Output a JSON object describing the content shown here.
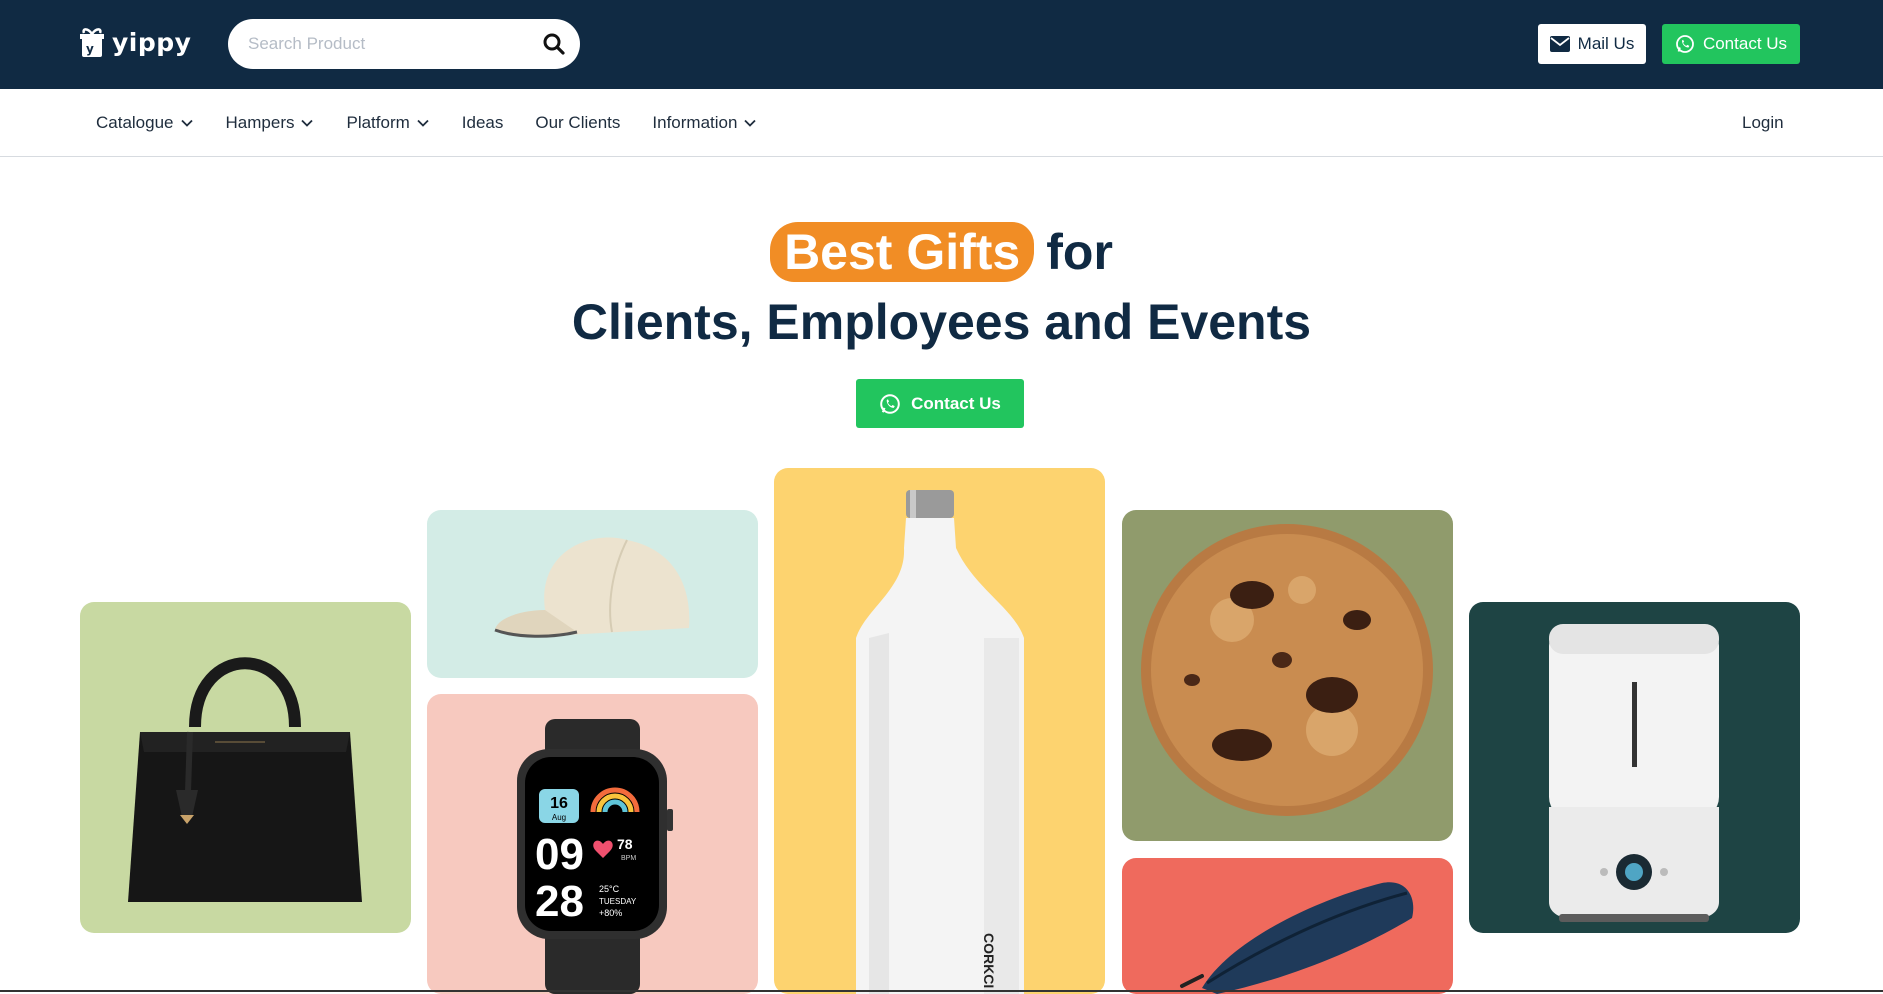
{
  "header": {
    "logo_text": "yippy",
    "search_placeholder": "Search Product",
    "mail_label": "Mail Us",
    "contact_label": "Contact Us"
  },
  "nav": {
    "items": [
      {
        "label": "Catalogue",
        "has_dropdown": true
      },
      {
        "label": "Hampers",
        "has_dropdown": true
      },
      {
        "label": "Platform",
        "has_dropdown": true
      },
      {
        "label": "Ideas",
        "has_dropdown": false
      },
      {
        "label": "Our Clients",
        "has_dropdown": false
      },
      {
        "label": "Information",
        "has_dropdown": true
      }
    ],
    "login_label": "Login"
  },
  "hero": {
    "highlight": "Best Gifts",
    "title_rest": "for",
    "subtitle": "Clients, Employees and Events",
    "cta_label": "Contact Us"
  },
  "products": [
    {
      "name": "handbag",
      "bg": "#c8d9a2"
    },
    {
      "name": "cap",
      "bg": "#d3ece6"
    },
    {
      "name": "smartwatch",
      "bg": "#f7c9bf",
      "watch_date": "16",
      "watch_month": "Aug",
      "watch_hour": "09",
      "watch_min": "28",
      "watch_bpm": "78",
      "watch_bpm_unit": "BPM",
      "watch_temp": "25°C",
      "watch_day": "TUESDAY",
      "watch_humidity": "+80%"
    },
    {
      "name": "bottle",
      "bg": "#fdd36f",
      "brand": "CORKCI"
    },
    {
      "name": "cookie",
      "bg": "#909b6c"
    },
    {
      "name": "pouch",
      "bg": "#ef6a5d"
    },
    {
      "name": "humidifier",
      "bg": "#1e4444"
    }
  ],
  "colors": {
    "navy": "#102a43",
    "green": "#22c55e",
    "orange": "#f18d25"
  }
}
